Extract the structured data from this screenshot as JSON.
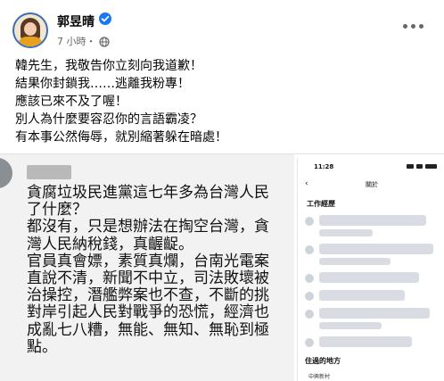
{
  "post": {
    "author": "郭昱晴",
    "time": "7 小時・",
    "lines": [
      "韓先生，我敬告你立刻向我道歉！",
      "結果你封鎖我……逃離我粉專！",
      "應該已來不及了喔！",
      "別人為什麼要容忍你的言語霸凌？",
      "有本事公然侮辱，就別縮著躲在暗處！"
    ]
  },
  "screenshot": {
    "quote_lines": [
      "貪腐垃圾民進黨這七年多為台灣人民",
      "了什麼？",
      "都沒有，只是想辦法在掏空台灣，貪",
      "灣人民納稅錢，真齷齪。",
      "官員真會嫖，素質真爛，台南光電案",
      "直說不清，新聞不中立，司法敗壞被",
      "治操控，潛艦弊案也不查，不斷的挑",
      "對岸引起人民對戰爭的恐慌，經濟也",
      "成亂七八糟，無能、無知、無恥到極",
      "點。"
    ],
    "phone": {
      "status_time": "11:28",
      "back_glyph": "‹",
      "title": "關於",
      "section_work": "工作經歷",
      "section_place": "住過的地方",
      "place_item": "中興新村"
    }
  },
  "icons": {
    "verified": "verified-badge-icon",
    "globe": "globe-icon",
    "more": "more-options-icon"
  },
  "colors": {
    "verified": "#1877f2",
    "secondary_text": "#65676b"
  }
}
